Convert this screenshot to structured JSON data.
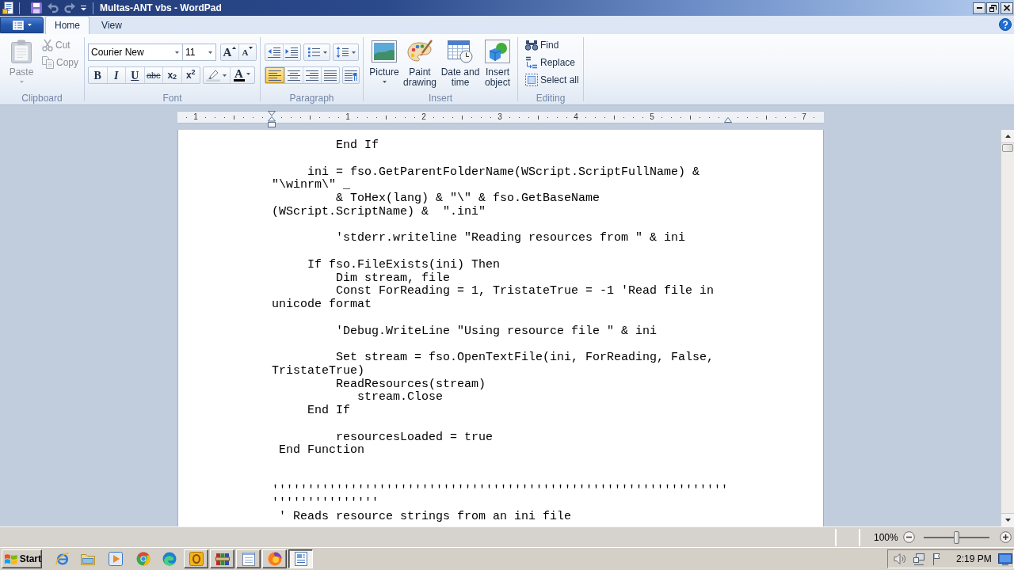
{
  "title_bar": {
    "title": "Multas-ANT vbs - WordPad",
    "quick_access": [
      {
        "kind": "save",
        "disabled": false
      },
      {
        "kind": "undo",
        "disabled": true
      },
      {
        "kind": "redo",
        "disabled": true
      }
    ]
  },
  "ribbon": {
    "tabs": [
      {
        "label": "Home",
        "selected": true
      },
      {
        "label": "View",
        "selected": false
      }
    ],
    "clipboard": {
      "label": "Clipboard",
      "paste": {
        "label": "Paste",
        "disabled": true
      },
      "commands": [
        {
          "kind": "cut",
          "label": "Cut",
          "disabled": true
        },
        {
          "kind": "copy",
          "label": "Copy",
          "disabled": true
        }
      ]
    },
    "font": {
      "label": "Font",
      "family": "Courier New",
      "size": "11",
      "size_buttons": [
        {
          "kind": "grow",
          "label": "A"
        },
        {
          "kind": "shrink",
          "label": "A"
        }
      ],
      "format_buttons": [
        {
          "kind": "bold",
          "label": "B"
        },
        {
          "kind": "italic",
          "label": "I"
        },
        {
          "kind": "underline",
          "label": "U"
        },
        {
          "kind": "strikethrough",
          "label": "abc"
        },
        {
          "kind": "subscript",
          "label": "x$_{2}$"
        },
        {
          "kind": "superscript",
          "label": "x$^{2}$"
        }
      ],
      "color_button": {
        "label": "A"
      }
    },
    "paragraph": {
      "label": "Paragraph",
      "alignment": [
        {
          "kind": "left",
          "selected": true
        },
        {
          "kind": "center",
          "selected": false
        },
        {
          "kind": "right",
          "selected": false
        },
        {
          "kind": "justify",
          "selected": false
        }
      ]
    },
    "insert": {
      "label": "Insert",
      "commands": [
        {
          "kind": "picture",
          "label": "Picture"
        },
        {
          "kind": "paint",
          "label": "Paint drawing"
        },
        {
          "kind": "datetime",
          "label": "Date and time"
        },
        {
          "kind": "object",
          "label": "Insert object"
        }
      ]
    },
    "editing": {
      "label": "Editing",
      "commands": [
        {
          "kind": "find",
          "label": "Find"
        },
        {
          "kind": "replace",
          "label": "Replace"
        },
        {
          "kind": "select",
          "label": "Select all"
        }
      ]
    }
  },
  "ruler": {
    "labels": [
      "1",
      "1",
      "2",
      "3",
      "4",
      "5",
      "7"
    ]
  },
  "document": {
    "lines": [
      {
        "kind": "code",
        "text": "         End If"
      },
      {
        "kind": "blank"
      },
      {
        "kind": "code",
        "text": "     ini = fso.GetParentFolderName(WScript.ScriptFullName) &"
      },
      {
        "kind": "code",
        "text": "\"\\winrm\\\" _"
      },
      {
        "kind": "code",
        "text": "         & ToHex(lang) & \"\\\" & fso.GetBaseName"
      },
      {
        "kind": "code",
        "text": "(WScript.ScriptName) &  \".ini\""
      },
      {
        "kind": "blank"
      },
      {
        "kind": "code",
        "text": "         'stderr.writeline \"Reading resources from \" & ini"
      },
      {
        "kind": "blank"
      },
      {
        "kind": "code",
        "text": "     If fso.FileExists(ini) Then"
      },
      {
        "kind": "code",
        "text": "         Dim stream, file"
      },
      {
        "kind": "code",
        "text": "         Const ForReading = 1, TristateTrue = -1 'Read file in"
      },
      {
        "kind": "code",
        "text": "unicode format"
      },
      {
        "kind": "blank"
      },
      {
        "kind": "code",
        "text": "         'Debug.WriteLine \"Using resource file \" & ini"
      },
      {
        "kind": "blank"
      },
      {
        "kind": "code",
        "text": "         Set stream = fso.OpenTextFile(ini, ForReading, False,"
      },
      {
        "kind": "code",
        "text": "TristateTrue)"
      },
      {
        "kind": "code",
        "text": "         ReadResources(stream)"
      },
      {
        "kind": "code",
        "text": "            stream.Close"
      },
      {
        "kind": "code",
        "text": "     End If"
      },
      {
        "kind": "blank"
      },
      {
        "kind": "code",
        "text": "         resourcesLoaded = true"
      },
      {
        "kind": "code",
        "text": " End Function"
      },
      {
        "kind": "blank"
      },
      {
        "kind": "blank"
      },
      {
        "kind": "code",
        "text": "''''''''''''''''''''''''''''''''''''''''''''''''''''''''''''''''"
      },
      {
        "kind": "code",
        "text": "'''''''''''''''"
      },
      {
        "kind": "code",
        "text": " ' Reads resource strings from an ini file"
      }
    ]
  },
  "status_bar": {
    "zoom": "100%",
    "zoom_slider": {
      "level": 0.5
    }
  },
  "taskbar": {
    "start": "Start",
    "tasks": [
      {
        "kind": "tile",
        "selected": false
      },
      {
        "kind": "books",
        "selected": false
      },
      {
        "kind": "notes",
        "selected": false
      },
      {
        "kind": "globe",
        "selected": false
      },
      {
        "kind": "document",
        "selected": true
      }
    ],
    "clock": "2:19 PM"
  }
}
